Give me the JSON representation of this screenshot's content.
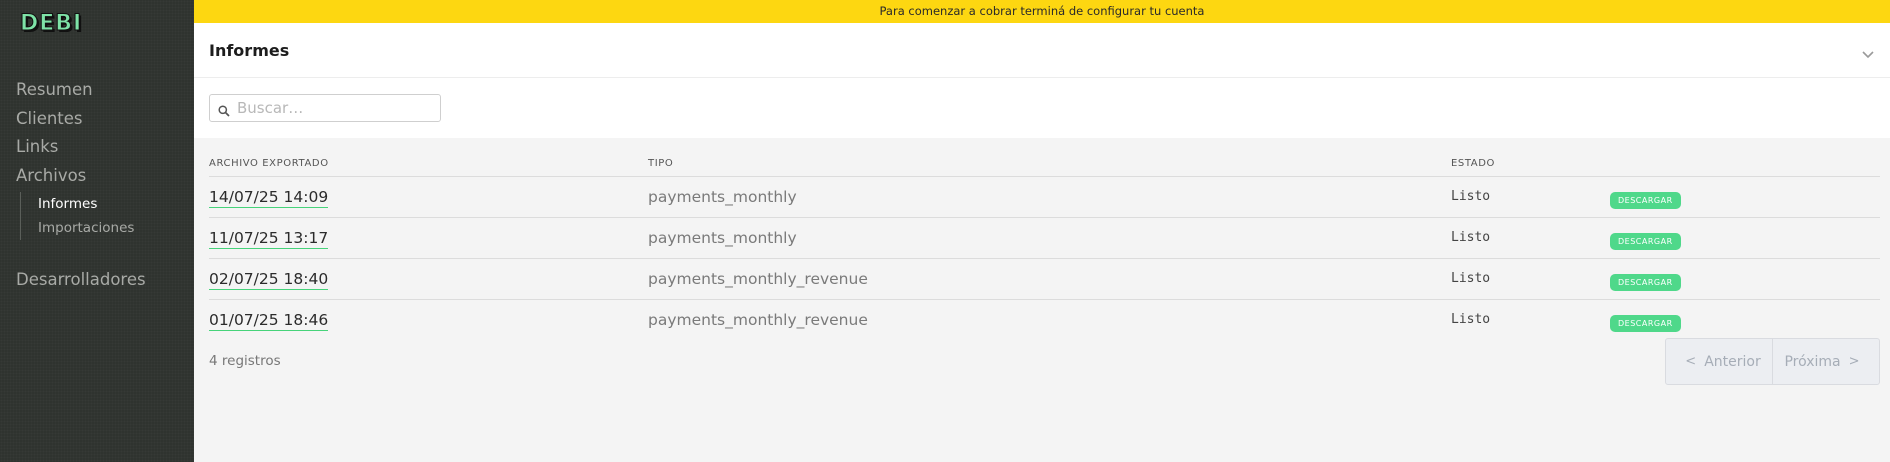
{
  "brand": {
    "logo_text": "DEBI"
  },
  "colors": {
    "banner": "#fdd711",
    "accent": "#4fd88a",
    "sidebar": "#2f332f"
  },
  "sidebar": {
    "items": [
      {
        "label": "Resumen"
      },
      {
        "label": "Clientes"
      },
      {
        "label": "Links"
      },
      {
        "label": "Archivos"
      }
    ],
    "subitems": [
      {
        "label": "Informes",
        "active": true
      },
      {
        "label": "Importaciones"
      }
    ],
    "developer": {
      "label": "Desarrolladores"
    }
  },
  "banner": {
    "text": "Para comenzar a cobrar terminá de configurar tu cuenta"
  },
  "header": {
    "title": "Informes",
    "collapse_icon": "chevron-down-icon"
  },
  "search": {
    "placeholder": "Buscar…",
    "value": ""
  },
  "table": {
    "columns": [
      "ARCHIVO EXPORTADO",
      "TIPO",
      "ESTADO"
    ],
    "rows": [
      {
        "date": "14/07/25 14:09",
        "type": "payments_monthly",
        "status": "Listo",
        "action": "DESCARGAR"
      },
      {
        "date": "11/07/25 13:17",
        "type": "payments_monthly",
        "status": "Listo",
        "action": "DESCARGAR"
      },
      {
        "date": "02/07/25 18:40",
        "type": "payments_monthly_revenue",
        "status": "Listo",
        "action": "DESCARGAR"
      },
      {
        "date": "01/07/25 18:46",
        "type": "payments_monthly_revenue",
        "status": "Listo",
        "action": "DESCARGAR"
      }
    ]
  },
  "footer": {
    "count": "4 registros",
    "prev_label": "Anterior",
    "next_label": "Próxima",
    "prev_arrow": "<",
    "next_arrow": ">"
  }
}
